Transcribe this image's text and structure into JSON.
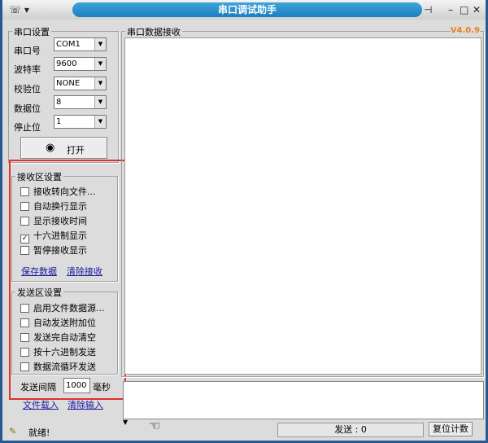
{
  "window": {
    "title": "串口调试助手",
    "version": "V4.0.9"
  },
  "serial": {
    "group": "串口设置",
    "rows": [
      {
        "label": "串口号",
        "value": "COM1"
      },
      {
        "label": "波特率",
        "value": "9600"
      },
      {
        "label": "校验位",
        "value": "NONE"
      },
      {
        "label": "数据位",
        "value": "8"
      },
      {
        "label": "停止位",
        "value": "1"
      }
    ],
    "open_label": "打开"
  },
  "receive_settings": {
    "group": "接收区设置",
    "options": [
      {
        "label": "接收转向文件...",
        "checked": false
      },
      {
        "label": "自动换行显示",
        "checked": false
      },
      {
        "label": "显示接收时间",
        "checked": false
      },
      {
        "label": "十六进制显示",
        "checked": true
      },
      {
        "label": "暂停接收显示",
        "checked": false
      }
    ],
    "save_label": "保存数据",
    "clear_label": "清除接收"
  },
  "send_settings": {
    "group": "发送区设置",
    "options": [
      {
        "label": "启用文件数据源...",
        "checked": false
      },
      {
        "label": "自动发送附加位",
        "checked": false
      },
      {
        "label": "发送完自动清空",
        "checked": false
      },
      {
        "label": "按十六进制发送",
        "checked": false
      },
      {
        "label": "数据流循环发送",
        "checked": false
      }
    ],
    "interval_label": "发送间隔",
    "interval_value": "1000",
    "interval_unit": "毫秒",
    "load_label": "文件载入",
    "clear_label": "清除输入"
  },
  "receive_area": {
    "title": "串口数据接收"
  },
  "status": {
    "text": "就绪!",
    "send": "发送 : 0",
    "reset_label": "复位计数"
  },
  "highlight_color": "#e03030"
}
